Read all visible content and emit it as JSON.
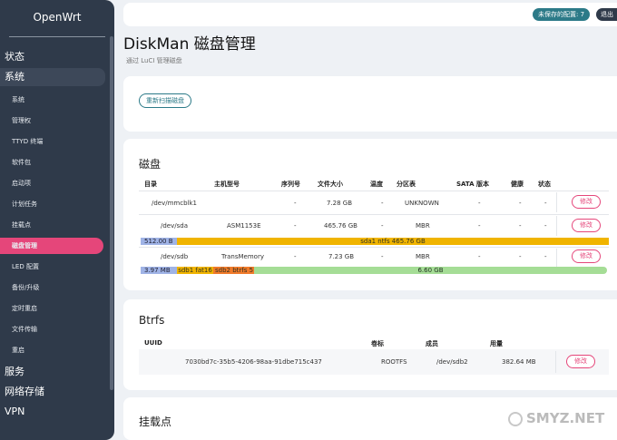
{
  "sidebar": {
    "brand": "OpenWrt",
    "top_items": [
      {
        "label": "状态"
      },
      {
        "label": "系统"
      }
    ],
    "sub_items": [
      {
        "label": "系统"
      },
      {
        "label": "管理权"
      },
      {
        "label": "TTYD 终端"
      },
      {
        "label": "软件包"
      },
      {
        "label": "启动项"
      },
      {
        "label": "计划任务"
      },
      {
        "label": "挂载点"
      },
      {
        "label": "磁盘管理"
      },
      {
        "label": "LED 配置"
      },
      {
        "label": "备份/升级"
      },
      {
        "label": "定时重启"
      },
      {
        "label": "文件传输"
      },
      {
        "label": "重启"
      }
    ],
    "bottom_items": [
      {
        "label": "服务"
      },
      {
        "label": "网络存储"
      },
      {
        "label": "VPN"
      }
    ]
  },
  "header": {
    "unsaved": "未保存的配置: 7",
    "logout": "退出"
  },
  "page": {
    "title": "DiskMan 磁盘管理",
    "desc": "通过 LuCI 管理磁盘",
    "rescan": "重新扫描磁盘"
  },
  "disks": {
    "title": "磁盘",
    "headers": [
      "目录",
      "主机型号",
      "序列号",
      "文件大小",
      "温度",
      "分区表",
      "SATA 版本",
      "健康",
      "状态"
    ],
    "rows": [
      {
        "path": "/dev/mmcblk1",
        "model": "",
        "serial": "-",
        "size": "7.28 GB",
        "temp": "-",
        "table": "UNKNOWN",
        "sata": "-",
        "health": "-",
        "status": "-",
        "edit": "修改"
      },
      {
        "path": "/dev/sda",
        "model": "ASM1153E",
        "serial": "-",
        "size": "465.76 GB",
        "temp": "-",
        "table": "MBR",
        "sata": "-",
        "health": "-",
        "status": "-",
        "edit": "修改"
      },
      {
        "path": "/dev/sdb",
        "model": "TransMemory",
        "serial": "-",
        "size": "7.23 GB",
        "temp": "-",
        "table": "MBR",
        "sata": "-",
        "health": "-",
        "status": "-",
        "edit": "修改"
      }
    ],
    "sda_bar": {
      "free": "512.00 B",
      "part": "sda1 ntfs 465.76 GB"
    },
    "sdb_bar": {
      "free": "3.97 MB",
      "part1": "sdb1 fat16",
      "part2": "sdb2 btrfs 5",
      "rest": "6.60 GB"
    }
  },
  "btrfs": {
    "title": "Btrfs",
    "headers": [
      "UUID",
      "卷标",
      "成员",
      "用量"
    ],
    "row": {
      "uuid": "7030bd7c-35b5-4206-98aa-91dbe715c437",
      "label": "ROOTFS",
      "members": "/dev/sdb2",
      "usage": "382.64 MB",
      "edit": "修改"
    }
  },
  "mounts": {
    "title": "挂载点"
  },
  "watermark": "SMYZ.NET",
  "colors": {
    "sidebar": "#2f3a4a",
    "accent_pink": "#e5467a",
    "accent_teal": "#2c7a88"
  }
}
